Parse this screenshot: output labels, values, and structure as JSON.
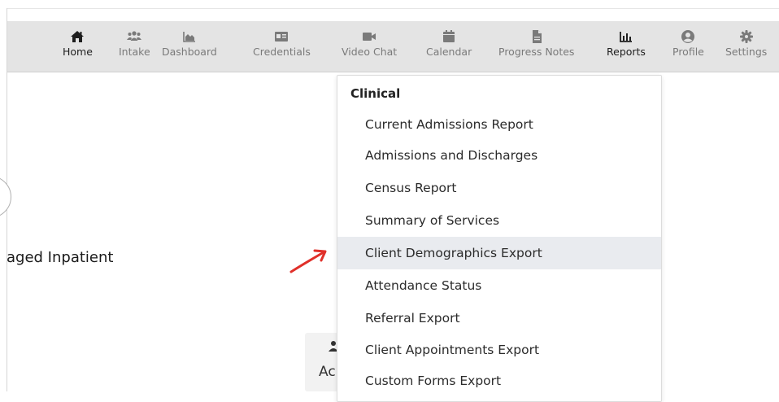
{
  "nav": {
    "items": [
      {
        "label": "Home",
        "icon": "home-icon",
        "active": true
      },
      {
        "label": "Intake",
        "icon": "users-icon",
        "active": false
      },
      {
        "label": "Dashboard",
        "icon": "area-chart-icon",
        "active": false
      },
      {
        "label": "Credentials",
        "icon": "id-card-icon",
        "active": false
      },
      {
        "label": "Video Chat",
        "icon": "video-camera-icon",
        "active": false
      },
      {
        "label": "Calendar",
        "icon": "calendar-icon",
        "active": false
      },
      {
        "label": "Progress Notes",
        "icon": "file-icon",
        "active": false
      },
      {
        "label": "Reports",
        "icon": "bar-chart-icon",
        "active": true
      },
      {
        "label": "Profile",
        "icon": "user-circle-icon",
        "active": false
      },
      {
        "label": "Settings",
        "icon": "gear-icon",
        "active": false
      }
    ],
    "background": "#e4e4e4"
  },
  "background_page": {
    "partial_heading": "aged Inpatient",
    "partial_card_label": "Ac"
  },
  "reports_menu": {
    "section_title": "Clinical",
    "items": [
      "Current Admissions Report",
      "Admissions and Discharges",
      "Census Report",
      "Summary of Services",
      "Client Demographics Export",
      "Attendance Status",
      "Referral Export",
      "Client Appointments Export",
      "Custom Forms Export"
    ],
    "highlighted_item": "Client Demographics Export",
    "highlight_color": "#e9ebef"
  },
  "annotation": {
    "arrow_color": "#e0302a"
  }
}
